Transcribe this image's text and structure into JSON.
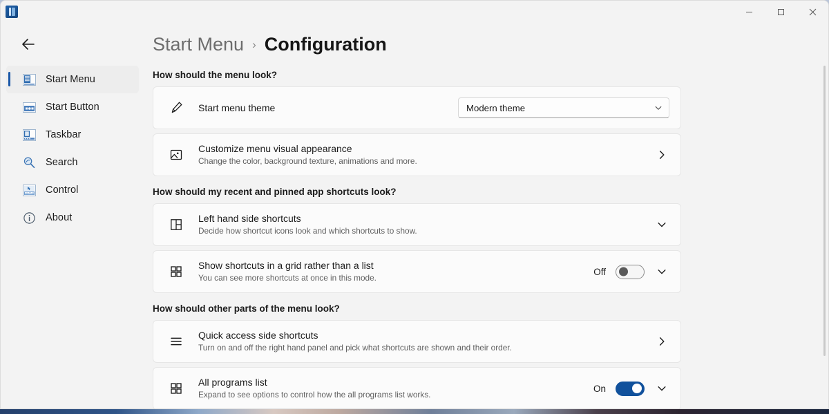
{
  "window": {
    "app_icon": "app-icon",
    "controls": {
      "minimize": "minimize",
      "maximize": "maximize",
      "close": "close"
    }
  },
  "sidebar": {
    "back_label": "back-arrow",
    "items": [
      {
        "label": "Start Menu",
        "icon": "start-menu-icon",
        "selected": true
      },
      {
        "label": "Start Button",
        "icon": "start-button-icon",
        "selected": false
      },
      {
        "label": "Taskbar",
        "icon": "taskbar-icon",
        "selected": false
      },
      {
        "label": "Search",
        "icon": "search-icon",
        "selected": false
      },
      {
        "label": "Control",
        "icon": "control-icon",
        "selected": false
      },
      {
        "label": "About",
        "icon": "info-icon",
        "selected": false
      }
    ]
  },
  "header": {
    "breadcrumb_parent": "Start Menu",
    "breadcrumb_separator": "›",
    "breadcrumb_current": "Configuration"
  },
  "sections": [
    {
      "title": "How should the menu look?",
      "rows": [
        {
          "icon": "paintbrush-icon",
          "title": "Start menu theme",
          "subtitle": "",
          "control": "dropdown",
          "dropdown_value": "Modern theme"
        },
        {
          "icon": "image-icon",
          "title": "Customize menu visual appearance",
          "subtitle": "Change the color, background texture, animations and more.",
          "control": "chevron-right"
        }
      ]
    },
    {
      "title": "How should my recent and pinned app shortcuts look?",
      "rows": [
        {
          "icon": "layout-panel-icon",
          "title": "Left hand side shortcuts",
          "subtitle": "Decide how shortcut icons look and which shortcuts to show.",
          "control": "chevron-down"
        },
        {
          "icon": "grid-icon",
          "title": "Show shortcuts in a grid rather than a list",
          "subtitle": "You can see more shortcuts at once in this mode.",
          "control": "toggle-chevron",
          "toggle_state": "Off",
          "toggle_on": false
        }
      ]
    },
    {
      "title": "How should other parts of the menu look?",
      "rows": [
        {
          "icon": "list-lines-icon",
          "title": "Quick access side shortcuts",
          "subtitle": "Turn on and off the right hand panel and pick what shortcuts are shown and their order.",
          "control": "chevron-right"
        },
        {
          "icon": "grid-icon",
          "title": "All programs list",
          "subtitle": "Expand to see options to control how the all programs list works.",
          "control": "toggle-chevron",
          "toggle_state": "On",
          "toggle_on": true
        }
      ]
    }
  ],
  "colors": {
    "accent": "#11519c",
    "selection_indicator": "#1a58a8",
    "window_bg": "#f3f3f3",
    "card_bg": "#fbfbfb"
  }
}
